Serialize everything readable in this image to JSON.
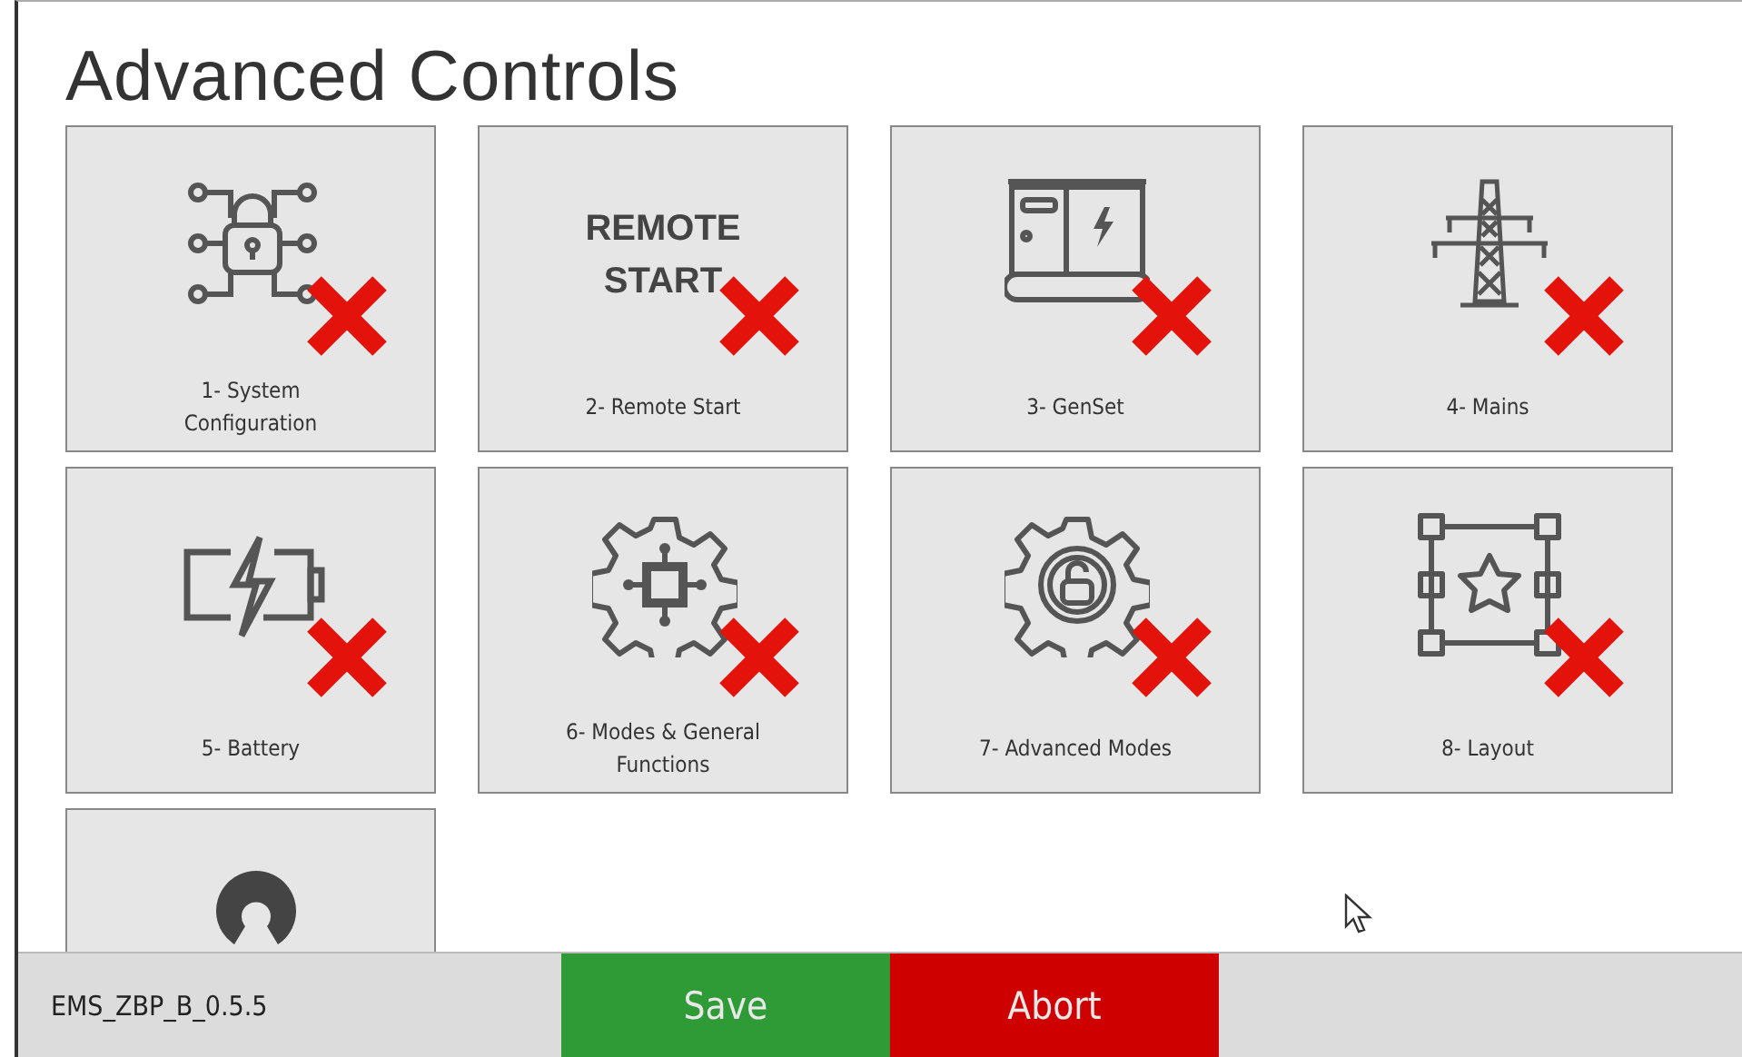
{
  "title": "Advanced Controls",
  "tiles": [
    {
      "kind": "icon",
      "label": "1- System Configuration",
      "unavailable": true
    },
    {
      "kind": "text",
      "art_text": "REMOTE START",
      "label": "2- Remote Start",
      "unavailable": true
    },
    {
      "kind": "icon",
      "label": "3- GenSet",
      "unavailable": true
    },
    {
      "kind": "icon",
      "label": "4- Mains",
      "unavailable": true
    },
    {
      "kind": "icon",
      "label": "5- Battery",
      "unavailable": true
    },
    {
      "kind": "icon",
      "label": "6- Modes & General Functions",
      "unavailable": true
    },
    {
      "kind": "icon",
      "label": "7- Advanced Modes",
      "unavailable": true
    },
    {
      "kind": "icon",
      "label": "8- Layout",
      "unavailable": true
    },
    {
      "kind": "icon"
    }
  ],
  "footer": {
    "version": "EMS_ZBP_B_0.5.5",
    "buttons": [
      {
        "kind": "save",
        "label": "Save"
      },
      {
        "kind": "abort",
        "label": "Abort"
      }
    ]
  }
}
